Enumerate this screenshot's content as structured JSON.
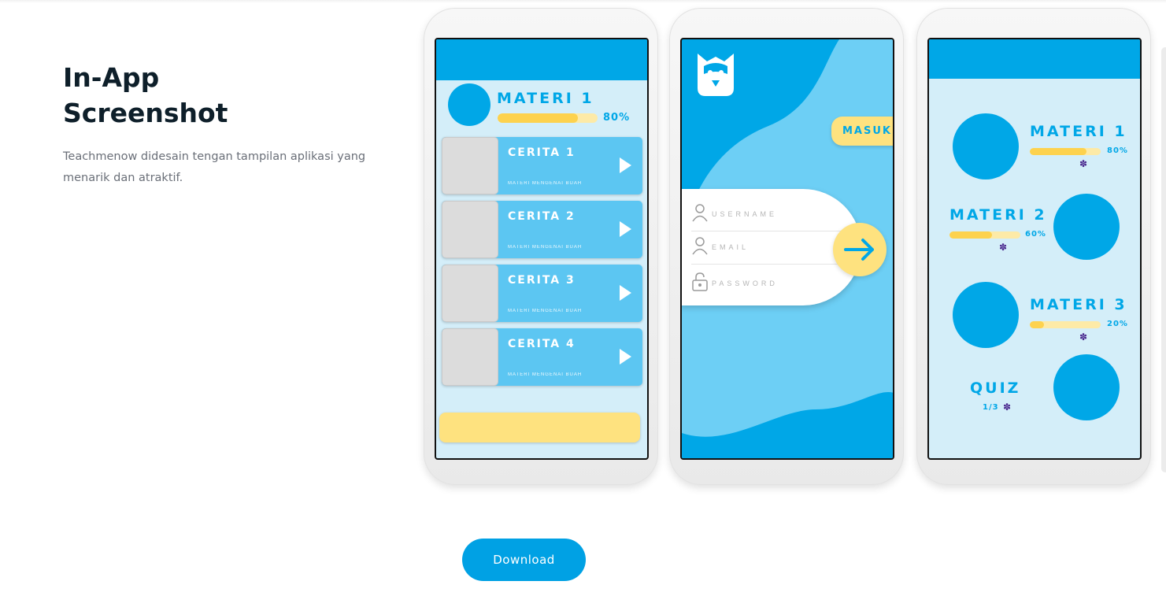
{
  "section": {
    "title_line1": "In-App",
    "title_line2": "Screenshot",
    "description": "Teachmenow didesain tengan tampilan aplikasi yang menarik dan atraktif."
  },
  "phone1": {
    "header_title": "MATERI 1",
    "progress_label": "80%",
    "progress": 0.8,
    "stories": [
      {
        "title": "CERITA 1",
        "subtitle": "MATERI MENGENAI BUAH"
      },
      {
        "title": "CERITA 2",
        "subtitle": "MATERI MENGENAI BUAH"
      },
      {
        "title": "CERITA 3",
        "subtitle": "MATERI MENGENAI BUAH"
      },
      {
        "title": "CERITA 4",
        "subtitle": "MATERI MENGENAI BUAH"
      }
    ]
  },
  "phone2": {
    "masuk_label": "MASUK",
    "username_label": "USERNAME",
    "email_label": "EMAIL",
    "password_label": "PASSWORD"
  },
  "phone3": {
    "items": [
      {
        "title": "MATERI 1",
        "progress_label": "80%",
        "progress": 0.8
      },
      {
        "title": "MATERI 2",
        "progress_label": "60%",
        "progress": 0.6
      },
      {
        "title": "MATERI 3",
        "progress_label": "20%",
        "progress": 0.2
      }
    ],
    "quiz_title": "QUIZ",
    "quiz_progress": "1/3"
  },
  "download_label": "Download",
  "colors": {
    "accent": "#00a7e7",
    "light_blue": "#5cc6f2",
    "yellow": "#fee27f",
    "progress_fill": "#fdd24e",
    "puzzle": "#4b2a8f"
  }
}
